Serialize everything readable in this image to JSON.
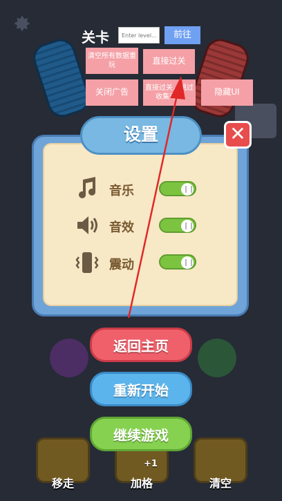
{
  "debug": {
    "level_title": "关卡",
    "level_input_placeholder": "Enter level...",
    "go_label": "前往",
    "clear_data_label": "清空所有数据重玩",
    "skip_level_label": "直接过关",
    "close_ads_label": "关闭广告",
    "skip_level_anim_label": "直接过关，跳过收集动画",
    "hide_ui_label": "隐藏UI"
  },
  "settings": {
    "title": "设置",
    "close_symbol": "✕",
    "rows": [
      {
        "label": "音乐",
        "icon": "music-note-icon",
        "on": true
      },
      {
        "label": "音效",
        "icon": "speaker-icon",
        "on": true
      },
      {
        "label": "震动",
        "icon": "vibration-icon",
        "on": true
      }
    ]
  },
  "actions": {
    "home_label": "返回主页",
    "restart_label": "重新开始",
    "continue_label": "继续游戏"
  },
  "bottom_bar": {
    "move_label": "移走",
    "add_slot_label": "加格",
    "add_slot_badge": "+1",
    "clear_label": "清空"
  },
  "colors": {
    "background": "#262b36",
    "toggle_on": "#7cc440",
    "home_button": "#f0606a",
    "restart_button": "#5cb4ec",
    "continue_button": "#86d250",
    "annotation_arrow": "#e02828"
  }
}
